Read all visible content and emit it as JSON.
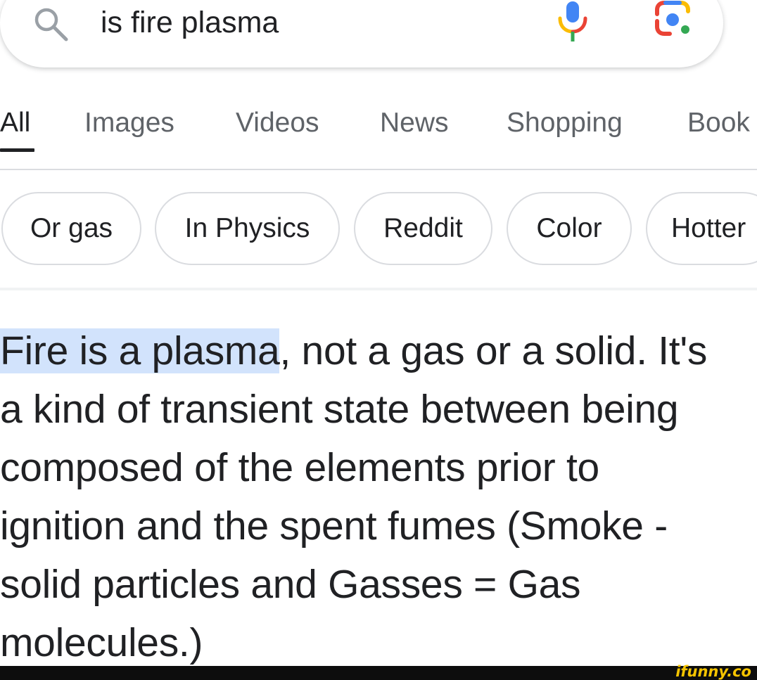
{
  "search": {
    "query": "is fire plasma",
    "icons": {
      "search": "search-icon",
      "mic": "mic-icon",
      "lens": "google-lens-icon"
    }
  },
  "tabs": [
    {
      "label": "All",
      "active": true
    },
    {
      "label": "Images"
    },
    {
      "label": "Videos"
    },
    {
      "label": "News"
    },
    {
      "label": "Shopping"
    },
    {
      "label": "Book"
    }
  ],
  "chips": [
    "Or gas",
    "In Physics",
    "Reddit",
    "Color",
    "Hotter"
  ],
  "answer": {
    "highlighted": "Fire is a plasma",
    "rest": ", not a gas or a solid. It's a kind of transient state between being composed of the elements prior to ignition and the spent fumes (Smoke - solid particles and Gasses = Gas molecules.)"
  },
  "watermark": "ifunny.co",
  "colors": {
    "highlight": "#d2e3fc",
    "text": "#202124",
    "tab_inactive": "#5f6368",
    "google_blue": "#4285f4",
    "google_red": "#ea4335",
    "google_yellow": "#fbbc04",
    "google_green": "#34a853",
    "watermark": "#f5c400"
  }
}
